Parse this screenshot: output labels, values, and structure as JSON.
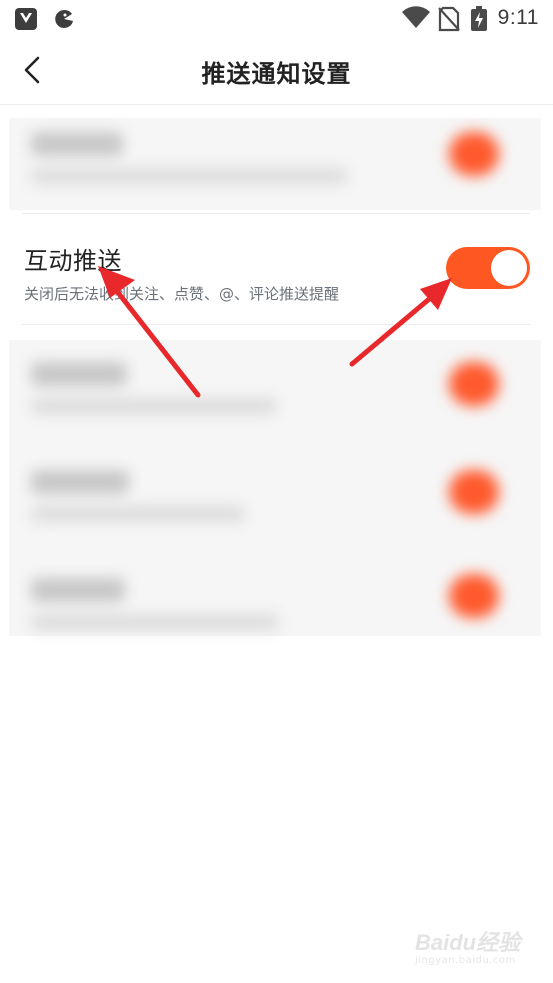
{
  "status_bar": {
    "time": "9:11",
    "icons": [
      "app-y-icon",
      "app-pacman-icon",
      "wifi-icon",
      "no-sim-icon",
      "battery-charging-icon"
    ]
  },
  "header": {
    "back_icon": "chevron-left-icon",
    "title": "推送通知设置"
  },
  "settings": {
    "interactive_push": {
      "title": "互动推送",
      "subtitle": "关闭后无法收到关注、点赞、@、评论推送提醒",
      "enabled": true
    }
  },
  "colors": {
    "accent": "#ff5722",
    "annotation_arrow": "#e8282b"
  },
  "watermark": {
    "brand": "Baidu经验",
    "domain": "jingyan.baidu.com"
  }
}
